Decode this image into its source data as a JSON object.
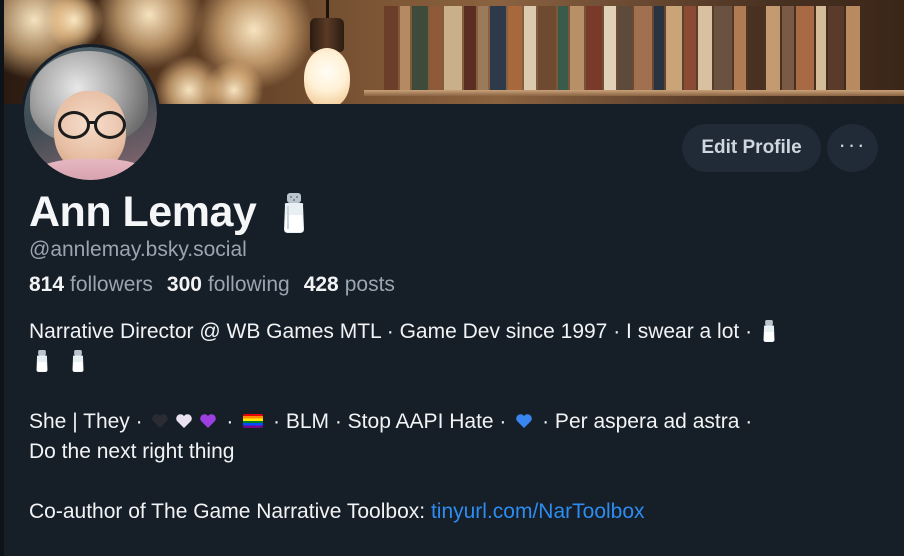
{
  "profile": {
    "name": "Ann Lemay",
    "handle": "@annlemay.bsky.social",
    "followers_count": "814",
    "followers_label": "followers",
    "following_count": "300",
    "following_label": "following",
    "posts_count": "428",
    "posts_label": "posts"
  },
  "actions": {
    "edit_profile": "Edit Profile",
    "more": "···"
  },
  "bio": {
    "line1": "Narrative Director @ WB Games MTL · Game Dev since 1997 · I swear a lot ·",
    "l2_she": "She | They ·",
    "l2_sep1": "·",
    "l2_sep2": "· BLM · Stop AAPI Hate ·",
    "l2_sep3": "· Per aspera ad astra  ·",
    "line3": "Do the next right thing",
    "coauthor_prefix": "Co-author of The Game Narrative Toolbox: ",
    "coauthor_link": "tinyurl.com/NarToolbox"
  },
  "icons": {
    "salt": "salt-shaker-icon",
    "more": "more-horizontal-icon"
  },
  "colors": {
    "background": "#161e27",
    "link": "#2d8cf0",
    "muted": "#9aa5b1",
    "button_bg": "#202b37"
  }
}
